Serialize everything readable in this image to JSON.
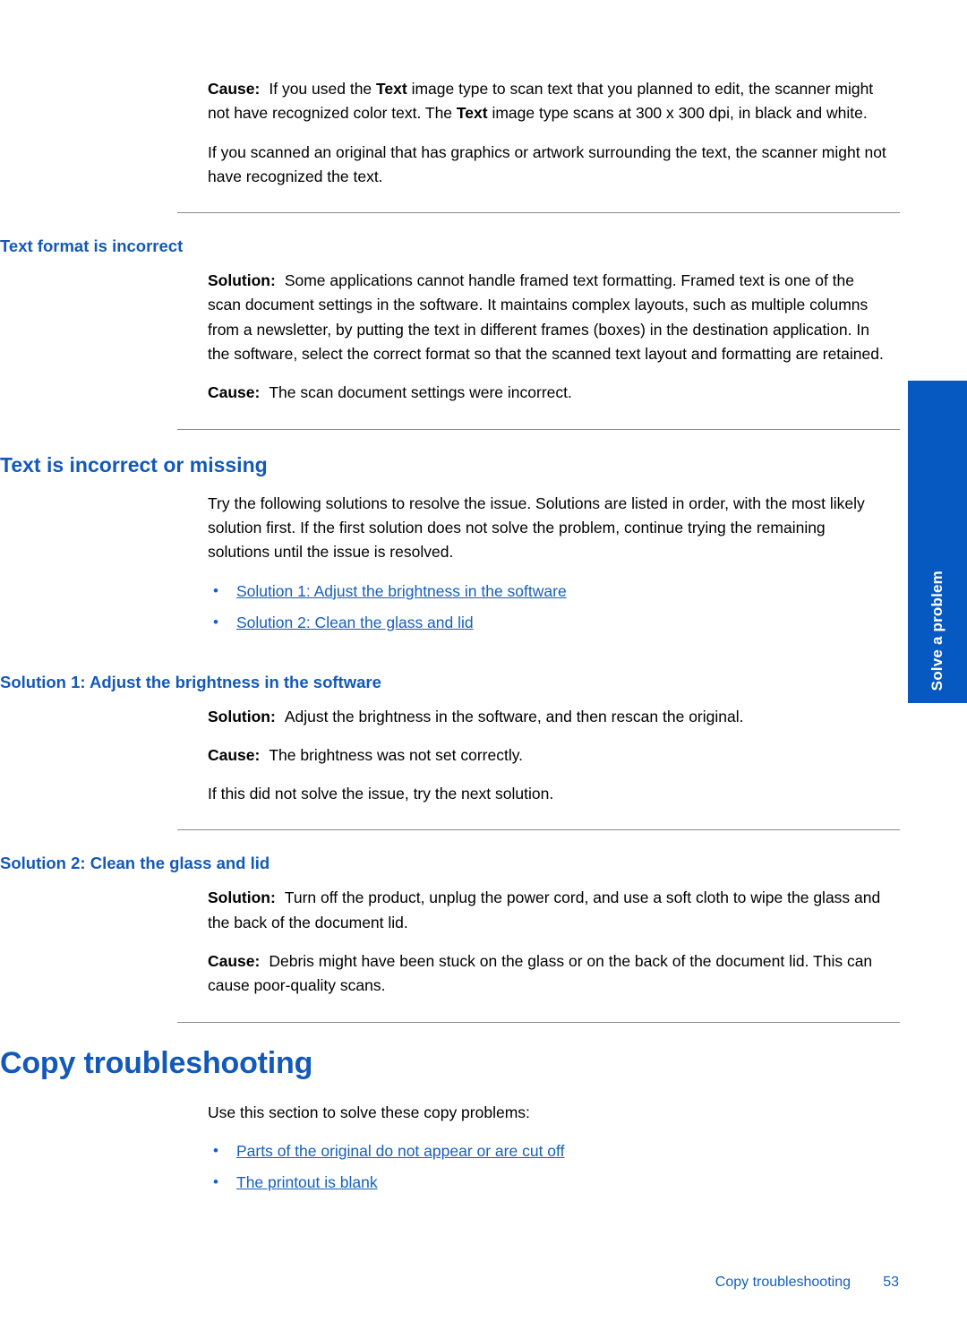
{
  "page": {
    "number": "53",
    "footer_section": "Copy troubleshooting"
  },
  "side_tab": {
    "label": "Solve a problem",
    "color": "#0659C0"
  },
  "colors": {
    "heading_blue": "#1359B8",
    "link_blue": "#1560BD",
    "tab_blue": "#0659C0",
    "rule_gray": "#8a8a8a"
  },
  "labels": {
    "cause": "Cause:",
    "solution": "Solution:"
  },
  "blocks": {
    "intro_cause": {
      "text_part1": "If you used the ",
      "bold1": "Text",
      "text_part2": " image type to scan text that you planned to edit, the scanner might not have recognized color text. The ",
      "bold2": "Text",
      "text_part3": " image type scans at 300 x 300 dpi, in black and white."
    },
    "intro_para2": "If you scanned an original that has graphics or artwork surrounding the text, the scanner might not have recognized the text.",
    "text_format": {
      "heading": "Text format is incorrect",
      "solution": "Some applications cannot handle framed text formatting. Framed text is one of the scan document settings in the software. It maintains complex layouts, such as multiple columns from a newsletter, by putting the text in different frames (boxes) in the destination application. In the software, select the correct format so that the scanned text layout and formatting are retained.",
      "cause": "The scan document settings were incorrect."
    },
    "text_incorrect": {
      "heading": "Text is incorrect or missing",
      "intro": "Try the following solutions to resolve the issue. Solutions are listed in order, with the most likely solution first. If the first solution does not solve the problem, continue trying the remaining solutions until the issue is resolved.",
      "links": [
        "Solution 1: Adjust the brightness in the software",
        "Solution 2: Clean the glass and lid"
      ]
    },
    "solution1": {
      "heading": "Solution 1: Adjust the brightness in the software",
      "solution": "Adjust the brightness in the software, and then rescan the original.",
      "cause": "The brightness was not set correctly.",
      "note": "If this did not solve the issue, try the next solution."
    },
    "solution2": {
      "heading": "Solution 2: Clean the glass and lid",
      "solution": "Turn off the product, unplug the power cord, and use a soft cloth to wipe the glass and the back of the document lid.",
      "cause": "Debris might have been stuck on the glass or on the back of the document lid. This can cause poor-quality scans."
    },
    "copy_troubleshooting": {
      "heading": "Copy troubleshooting",
      "intro": "Use this section to solve these copy problems:",
      "links": [
        "Parts of the original do not appear or are cut off",
        "The printout is blank"
      ]
    }
  },
  "bullet_glyph": "•"
}
